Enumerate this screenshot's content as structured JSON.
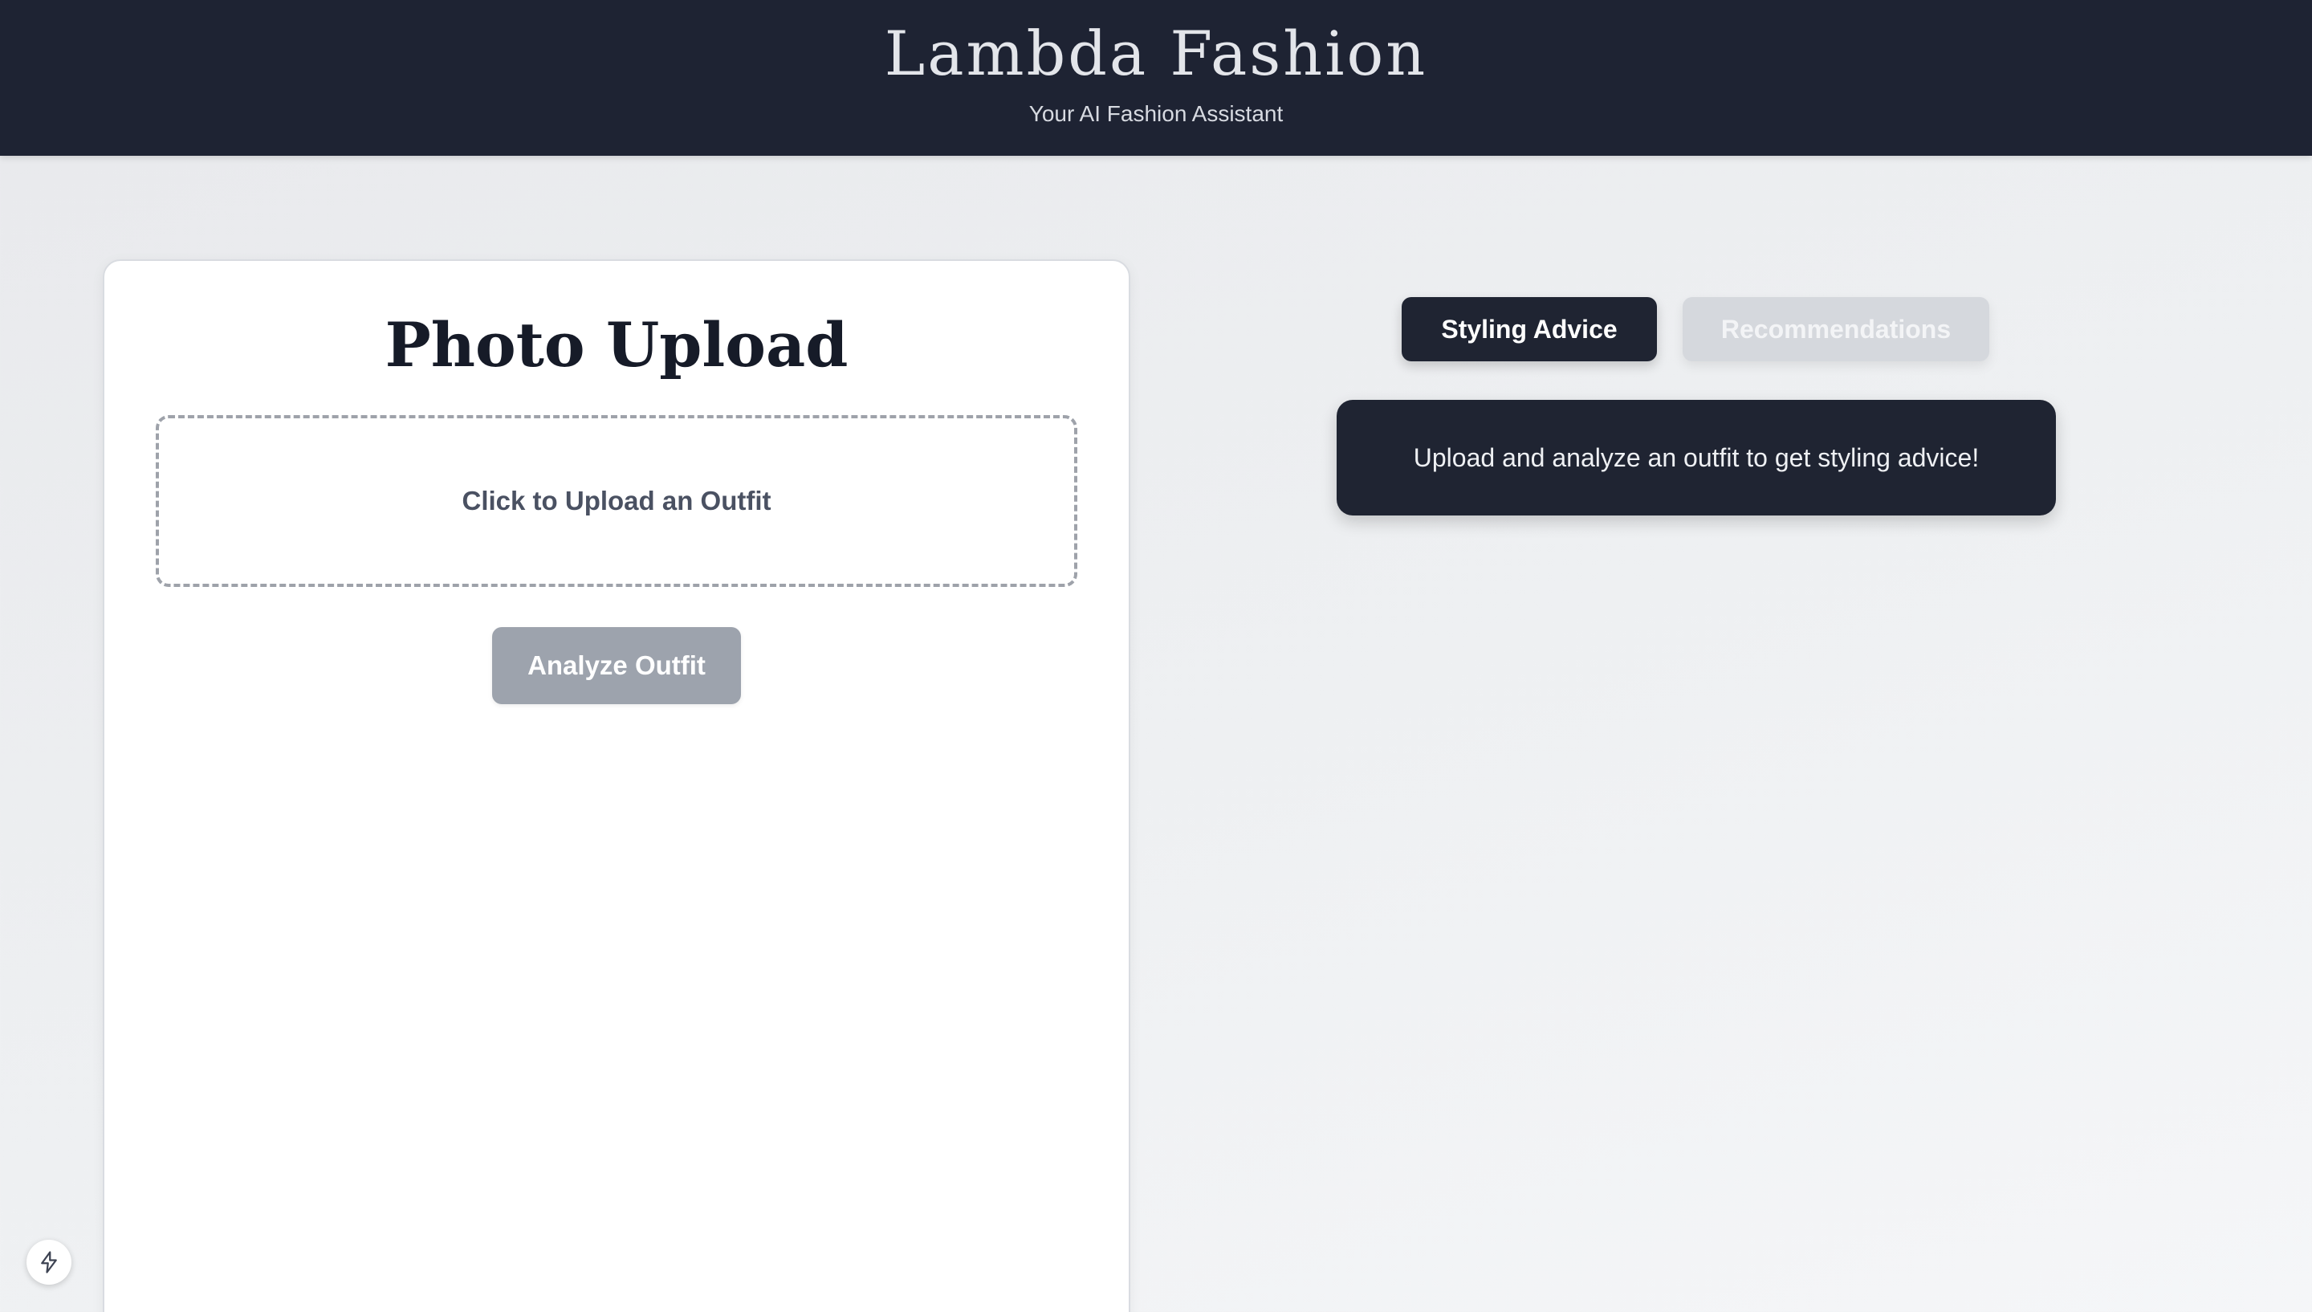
{
  "header": {
    "title": "Lambda Fashion",
    "subtitle": "Your AI Fashion Assistant"
  },
  "upload_card": {
    "title": "Photo Upload",
    "dropzone_label": "Click to Upload an Outfit",
    "analyze_button_label": "Analyze Outfit"
  },
  "tabs": [
    {
      "label": "Styling Advice",
      "active": true
    },
    {
      "label": "Recommendations",
      "active": false
    }
  ],
  "advice": {
    "message": "Upload and analyze an outfit to get styling advice!"
  },
  "icons": {
    "corner_badge": "lightning-bolt-icon"
  },
  "colors": {
    "header_bg": "#1e2333",
    "active_tab": "#1f2432",
    "inactive_tab": "#d5d8dd",
    "analyze_button": "#9da3ad"
  }
}
